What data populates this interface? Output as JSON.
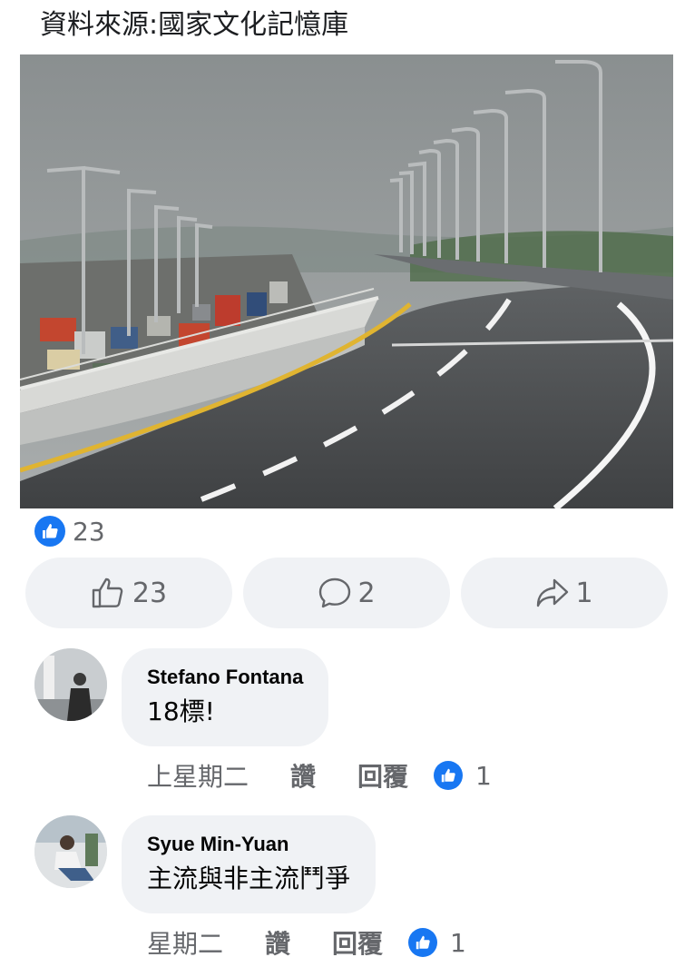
{
  "post": {
    "caption": "資料來源:國家文化記憶庫"
  },
  "reactions": {
    "icon": "thumbs-up-icon",
    "count": "23",
    "color": "#1877f2"
  },
  "actions": {
    "like": {
      "icon": "thumbs-up-outline-icon",
      "count": "23"
    },
    "comment": {
      "icon": "comment-bubble-icon",
      "count": "2"
    },
    "share": {
      "icon": "share-arrow-icon",
      "count": "1"
    }
  },
  "comments": [
    {
      "author": "Stefano Fontana",
      "text": "18標!",
      "time": "上星期二",
      "like_label": "讚",
      "reply_label": "回覆",
      "reaction_count": "1"
    },
    {
      "author": "Syue Min-Yuan",
      "text": "主流與非主流鬥爭",
      "time": "星期二",
      "like_label": "讚",
      "reply_label": "回覆",
      "reaction_count": "1"
    }
  ],
  "colors": {
    "background": "#ffffff",
    "button_bg": "#f0f2f5",
    "secondary_text": "#65676b",
    "accent": "#1877f2"
  }
}
